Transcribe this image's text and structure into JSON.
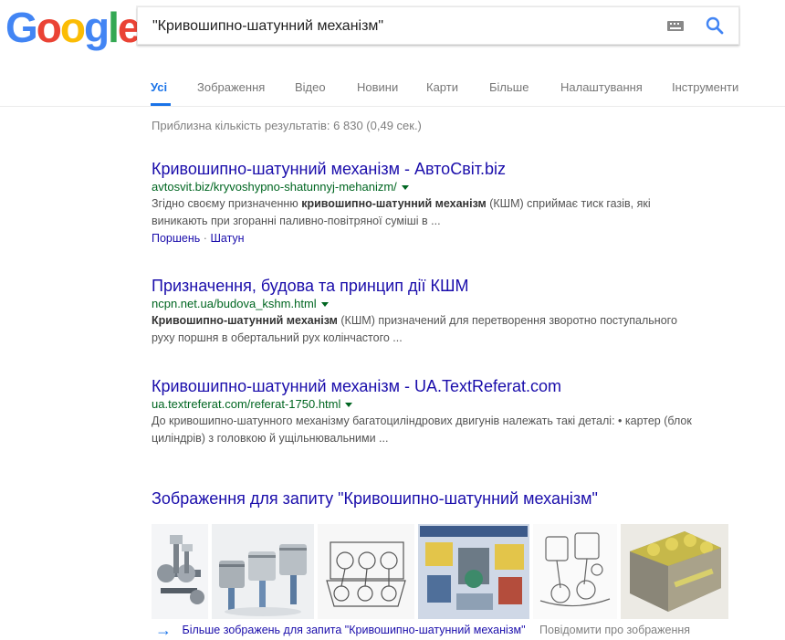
{
  "logo": {
    "letters": [
      "G",
      "o",
      "o",
      "g",
      "l",
      "e"
    ],
    "colors": [
      "#4285f4",
      "#ea4335",
      "#fbbc05",
      "#4285f4",
      "#34a853",
      "#ea4335"
    ]
  },
  "search": {
    "query": "\"Кривошипно-шатунний механізм\"",
    "keyboard_icon": "keyboard-icon",
    "search_icon": "search-icon",
    "accent": "#4285f4"
  },
  "tabs": [
    {
      "label": "Усі",
      "active": true
    },
    {
      "label": "Зображення"
    },
    {
      "label": "Відео"
    },
    {
      "label": "Новини"
    },
    {
      "label": "Карти"
    },
    {
      "label": "Більше"
    },
    {
      "label": "Налаштування"
    },
    {
      "label": "Інструменти"
    }
  ],
  "stats": "Приблизна кількість результатів: 6 830 (0,49 сек.)",
  "results": [
    {
      "title": "Кривошипно-шатунний механізм - АвтоСвіт.biz",
      "url": "avtosvit.biz/kryvoshypno-shatunnyj-mehanizm/",
      "snippet_line1_pre": "Згідно своєму призначенню ",
      "snippet_line1_bold": "кривошипно-шатунний механізм",
      "snippet_line1_post": " (КШМ) сприймає тиск газів, які",
      "snippet_line2": "виникають при згоранні паливно-повітряної суміші в ...",
      "sitelinks": [
        "Поршень",
        "Шатун"
      ],
      "sitelink_sep": "·"
    },
    {
      "title": "Призначення, будова та принцип дії КШМ",
      "url": "ncpn.net.ua/budova_kshm.html",
      "snippet_line1_pre": "",
      "snippet_line1_bold": "Кривошипно-шатунний механізм",
      "snippet_line1_post": " (КШМ) призначений для перетворення зворотно поступального",
      "snippet_line2": "руху поршня в обертальний рух колінчастого ..."
    },
    {
      "title": "Кривошипно-шатунний механізм - UA.TextReferat.com",
      "url": "ua.textreferat.com/referat-1750.html",
      "snippet_line1_pre": "До кривошипно-шатунного механізму багатоциліндрових двигунів належать такі деталі: • картер (блок",
      "snippet_line1_bold": "",
      "snippet_line1_post": "",
      "snippet_line2": "циліндрів) з головкою й ущільнювальними ..."
    }
  ],
  "images": {
    "header": "Зображення для запиту \"Кривошипно-шатунний механізм\"",
    "thumbnails": [
      "crankshaft-assembly-image",
      "pistons-image",
      "engine-drawing-image",
      "ksm-poster-image",
      "piston-sketch-image",
      "engine-block-image"
    ],
    "more_link": "Більше зображень для запита \"Кривошипно-шатунний механізм\"",
    "report_link": "Повідомити про зображення"
  }
}
